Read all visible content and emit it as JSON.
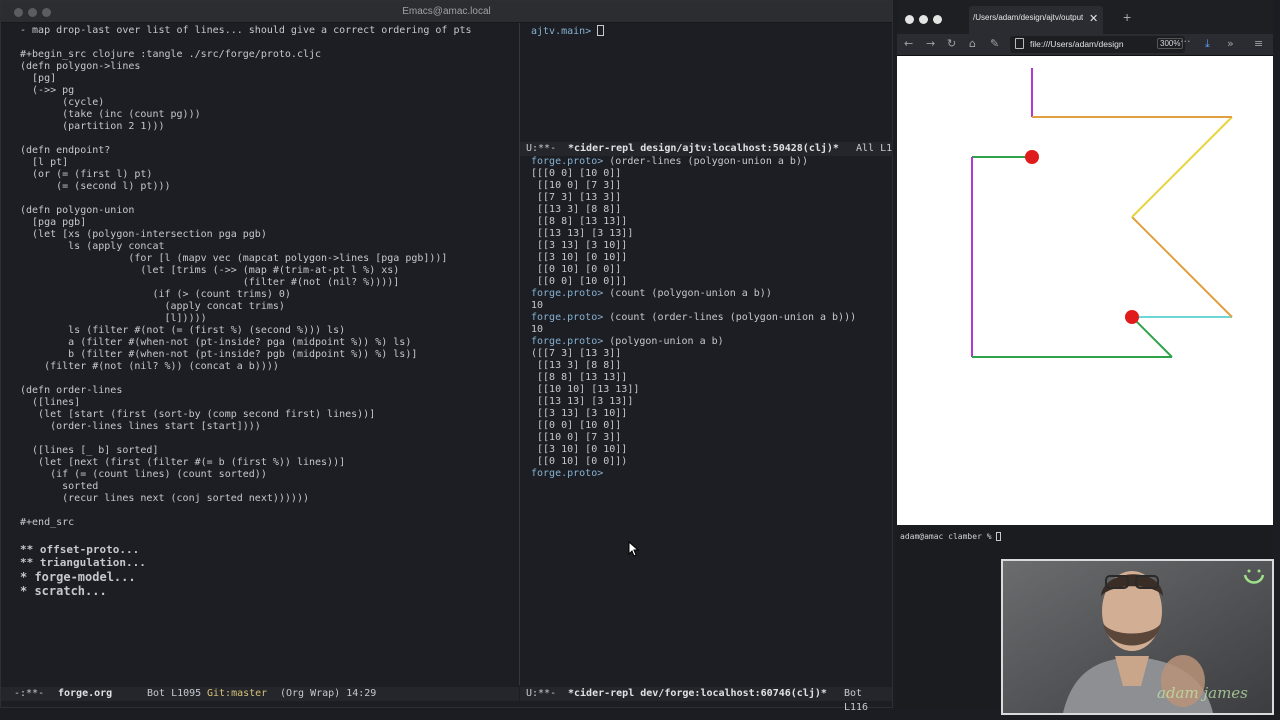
{
  "emacs": {
    "window_title": "Emacs@amac.local",
    "left_lines": [
      {
        "cls": "",
        "text": "- map drop-last over list of lines... should give a correct ordering of pts"
      },
      {
        "cls": "",
        "text": ""
      },
      {
        "cls": "cmt",
        "text": "#+begin_src clojure :tangle ./src/forge/proto.cljc"
      },
      {
        "cls": "",
        "text": "(defn polygon->lines"
      },
      {
        "cls": "",
        "text": "  [pg]"
      },
      {
        "cls": "",
        "text": "  (->> pg"
      },
      {
        "cls": "",
        "text": "       (cycle)"
      },
      {
        "cls": "",
        "text": "       (take (inc (count pg)))"
      },
      {
        "cls": "",
        "text": "       (partition 2 1)))"
      },
      {
        "cls": "",
        "text": ""
      },
      {
        "cls": "",
        "text": "(defn endpoint?"
      },
      {
        "cls": "",
        "text": "  [l pt]"
      },
      {
        "cls": "",
        "text": "  (or (= (first l) pt)"
      },
      {
        "cls": "",
        "text": "      (= (second l) pt)))"
      },
      {
        "cls": "",
        "text": ""
      },
      {
        "cls": "",
        "text": "(defn polygon-union"
      },
      {
        "cls": "",
        "text": "  [pga pgb]"
      },
      {
        "cls": "",
        "text": "  (let [xs (polygon-intersection pga pgb)"
      },
      {
        "cls": "",
        "text": "        ls (apply concat"
      },
      {
        "cls": "",
        "text": "                  (for [l (mapv vec (mapcat polygon->lines [pga pgb]))]"
      },
      {
        "cls": "",
        "text": "                    (let [trims (->> (map #(trim-at-pt l %) xs)"
      },
      {
        "cls": "",
        "text": "                                     (filter #(not (nil? %))))]"
      },
      {
        "cls": "",
        "text": "                      (if (> (count trims) 0)"
      },
      {
        "cls": "",
        "text": "                        (apply concat trims)"
      },
      {
        "cls": "",
        "text": "                        [l]))))"
      },
      {
        "cls": "",
        "text": "        ls (filter #(not (= (first %) (second %))) ls)"
      },
      {
        "cls": "",
        "text": "        a (filter #(when-not (pt-inside? pga (midpoint %)) %) ls)"
      },
      {
        "cls": "",
        "text": "        b (filter #(when-not (pt-inside? pgb (midpoint %)) %) ls)]"
      },
      {
        "cls": "",
        "text": "    (filter #(not (nil? %)) (concat a b))))"
      },
      {
        "cls": "",
        "text": ""
      },
      {
        "cls": "",
        "text": "(defn order-lines"
      },
      {
        "cls": "",
        "text": "  ([lines]"
      },
      {
        "cls": "",
        "text": "   (let [start (first (sort-by (comp second first) lines))]"
      },
      {
        "cls": "",
        "text": "     (order-lines lines start [start])))"
      },
      {
        "cls": "",
        "text": ""
      },
      {
        "cls": "",
        "text": "  ([lines [_ b] sorted]"
      },
      {
        "cls": "",
        "text": "   (let [next (first (filter #(= b (first %)) lines))]"
      },
      {
        "cls": "",
        "text": "     (if (= (count lines) (count sorted))"
      },
      {
        "cls": "",
        "text": "       sorted"
      },
      {
        "cls": "",
        "text": "       (recur lines next (conj sorted next))))))"
      },
      {
        "cls": "",
        "text": ""
      },
      {
        "cls": "cmt",
        "text": "#+end_src"
      },
      {
        "cls": "",
        "text": ""
      },
      {
        "cls": "hd2",
        "text": "** offset-proto..."
      },
      {
        "cls": "hd2",
        "text": "** triangulation..."
      },
      {
        "cls": "hd1",
        "text": "* forge-model..."
      },
      {
        "cls": "hd1",
        "text": "* scratch..."
      }
    ],
    "top_repl_prompt": "ajtv.main>",
    "top_modeline": {
      "status": "U:**-",
      "buffer": "*cider-repl design/ajtv:localhost:50428(clj)*",
      "position": "All L1"
    },
    "repl_lines": [
      {
        "cls": "prompt",
        "text": "forge.proto> ",
        "rest": "(order-lines (polygon-union a b))"
      },
      {
        "cls": "",
        "text": "[[[0 0] [10 0]]"
      },
      {
        "cls": "",
        "text": " [[10 0] [7 3]]"
      },
      {
        "cls": "",
        "text": " [[7 3] [13 3]]"
      },
      {
        "cls": "",
        "text": " [[13 3] [8 8]]"
      },
      {
        "cls": "",
        "text": " [[8 8] [13 13]]"
      },
      {
        "cls": "",
        "text": " [[13 13] [3 13]]"
      },
      {
        "cls": "",
        "text": " [[3 13] [3 10]]"
      },
      {
        "cls": "",
        "text": " [[3 10] [0 10]]"
      },
      {
        "cls": "",
        "text": " [[0 10] [0 0]]"
      },
      {
        "cls": "",
        "text": " [[0 0] [10 0]]]"
      },
      {
        "cls": "prompt",
        "text": "forge.proto> ",
        "rest": "(count (polygon-union a b))"
      },
      {
        "cls": "",
        "text": "10"
      },
      {
        "cls": "prompt",
        "text": "forge.proto> ",
        "rest": "(count (order-lines (polygon-union a b)))"
      },
      {
        "cls": "",
        "text": "10"
      },
      {
        "cls": "prompt",
        "text": "forge.proto> ",
        "rest": "(polygon-union a b)"
      },
      {
        "cls": "",
        "text": "([[7 3] [13 3]]"
      },
      {
        "cls": "",
        "text": " [[13 3] [8 8]]"
      },
      {
        "cls": "",
        "text": " [[8 8] [13 13]]"
      },
      {
        "cls": "",
        "text": " [[10 10] [13 13]]"
      },
      {
        "cls": "",
        "text": " [[13 13] [3 13]]"
      },
      {
        "cls": "",
        "text": " [[3 13] [3 10]]"
      },
      {
        "cls": "",
        "text": " [[0 0] [10 0]]"
      },
      {
        "cls": "",
        "text": " [[10 0] [7 3]]"
      },
      {
        "cls": "",
        "text": " [[3 10] [0 10]]"
      },
      {
        "cls": "",
        "text": " [[0 10] [0 0]])"
      },
      {
        "cls": "prompt",
        "text": "forge.proto>",
        "rest": ""
      }
    ],
    "left_modeline": {
      "status": "-:**-",
      "buffer": "forge.org",
      "position": "Bot L1095",
      "git": "Git:master",
      "mode": "(Org Wrap) 14:29"
    },
    "right_modeline": {
      "status": "U:**-",
      "buffer": "*cider-repl dev/forge:localhost:60746(clj)*",
      "position": "Bot L116"
    }
  },
  "browser": {
    "tab_title": "/Users/adam/design/ajtv/output/te",
    "url": "file:///Users/adam/design",
    "zoom": "300%",
    "colors": {
      "magenta": "#b03ad0",
      "orange": "#e0a040",
      "yellow": "#e8d23a",
      "cyan": "#6fd6d6",
      "green": "#2ea34a",
      "red": "#e01b1b"
    }
  },
  "terminal": {
    "prompt": "adam@amac clamber % "
  },
  "webcam": {
    "watermark": "adam james"
  }
}
